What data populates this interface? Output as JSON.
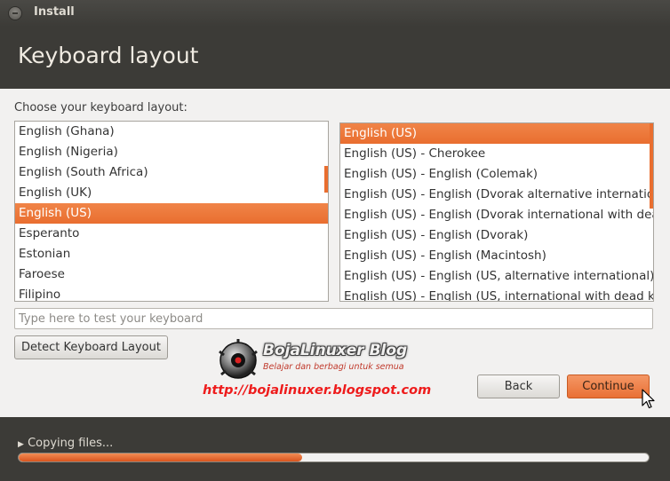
{
  "window": {
    "title": "Install"
  },
  "page": {
    "title": "Keyboard layout",
    "choose_label": "Choose your keyboard layout:"
  },
  "layouts": {
    "items": [
      "English (Ghana)",
      "English (Nigeria)",
      "English (South Africa)",
      "English (UK)",
      "English (US)",
      "Esperanto",
      "Estonian",
      "Faroese",
      "Filipino"
    ],
    "selected": "English (US)"
  },
  "variants": {
    "items": [
      "English (US)",
      "English (US) - Cherokee",
      "English (US) - English (Colemak)",
      "English (US) - English (Dvorak alternative international",
      "English (US) - English (Dvorak international with dead",
      "English (US) - English (Dvorak)",
      "English (US) - English (Macintosh)",
      "English (US) - English (US, alternative international)",
      "English (US) - English (US, international with dead key"
    ],
    "selected": "English (US)"
  },
  "test_input": {
    "placeholder": "Type here to test your keyboard",
    "value": ""
  },
  "buttons": {
    "detect": "Detect Keyboard Layout",
    "back": "Back",
    "continue": "Continue"
  },
  "watermark": {
    "name": "BojaLinuxer Blog",
    "tagline": "Belajar dan berbagi untuk semua",
    "url": "http://bojalinuxer.blogspot.com"
  },
  "progress": {
    "label": "Copying files...",
    "fraction": 0.45
  },
  "icons": {
    "close": "close-icon",
    "expander": "expander-triangle-icon",
    "logo": "bojalinuxer-logo-icon",
    "cursor": "mouse-pointer-icon"
  },
  "colors": {
    "accent": "#e96e2f",
    "window_bg": "#3c3b37",
    "content_bg": "#f2f1f0",
    "watermark_url": "#ee1c1c"
  }
}
